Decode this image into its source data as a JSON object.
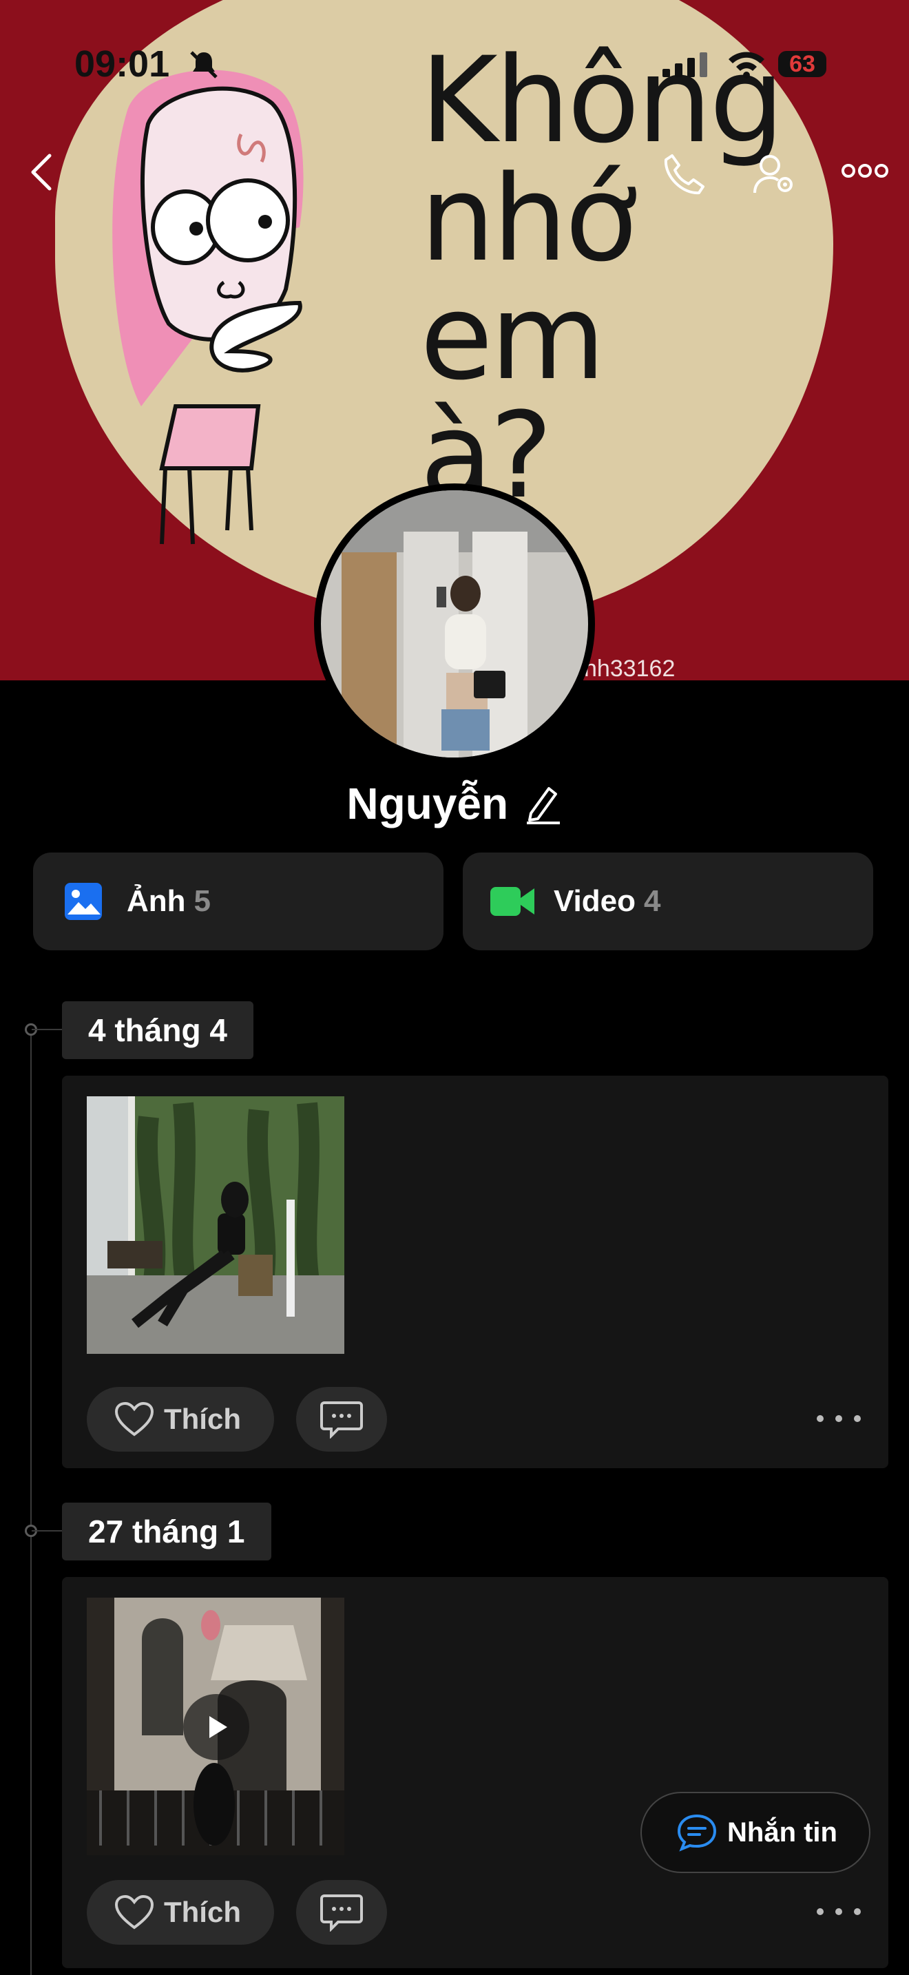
{
  "status_bar": {
    "time": "09:01",
    "battery": "63"
  },
  "cover": {
    "sticker_text": "Không\nnhớ\nem\nà?",
    "handle": "nh33162"
  },
  "profile": {
    "name": "Nguyễn"
  },
  "media": {
    "photos": {
      "label": "Ảnh",
      "count": "5"
    },
    "videos": {
      "label": "Video",
      "count": "4"
    }
  },
  "posts": [
    {
      "date": "4 tháng 4",
      "like_label": "Thích"
    },
    {
      "date": "27 tháng 1",
      "like_label": "Thích"
    }
  ],
  "message_button": {
    "label": "Nhắn tin"
  },
  "colors": {
    "cover_bg": "#8c0f1c",
    "sticker_bg": "#dccca5",
    "photo_icon": "#1a6ff0",
    "video_icon": "#2ecc5a",
    "message_icon": "#2a8cf0"
  },
  "icons": [
    "back-icon",
    "phone-icon",
    "user-settings-icon",
    "more-icon",
    "edit-icon",
    "photo-icon",
    "video-icon",
    "heart-icon",
    "comment-icon",
    "play-icon",
    "chat-icon"
  ]
}
